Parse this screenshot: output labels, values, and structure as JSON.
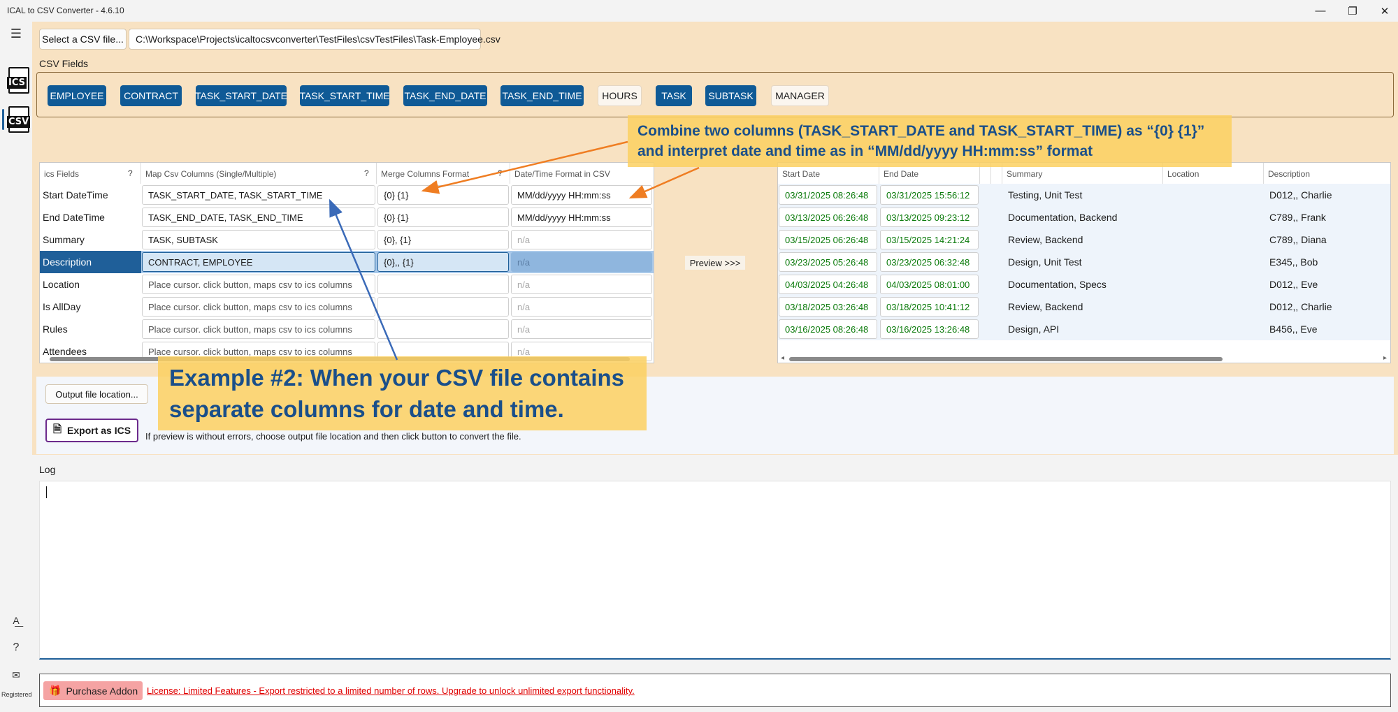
{
  "window": {
    "title": "ICAL to CSV Converter -  4.6.10"
  },
  "rail": {
    "ics_label": "ICS",
    "csv_label": "CSV",
    "registered": "Registered Jignesh De"
  },
  "file": {
    "select_button": "Select a CSV file...",
    "path": "C:\\Workspace\\Projects\\icaltocsvconverter\\TestFiles\\csvTestFiles\\Task-Employee.csv"
  },
  "csv_fields": {
    "label": "CSV Fields",
    "chips": [
      {
        "label": "EMPLOYEE",
        "mapped": true
      },
      {
        "label": "CONTRACT",
        "mapped": true
      },
      {
        "label": "TASK_START_DATE",
        "mapped": true
      },
      {
        "label": "TASK_START_TIME",
        "mapped": true
      },
      {
        "label": "TASK_END_DATE",
        "mapped": true
      },
      {
        "label": "TASK_END_TIME",
        "mapped": true
      },
      {
        "label": "HOURS",
        "mapped": false
      },
      {
        "label": "TASK",
        "mapped": true
      },
      {
        "label": "SUBTASK",
        "mapped": true
      },
      {
        "label": "MANAGER",
        "mapped": false
      }
    ]
  },
  "mapping": {
    "headers": {
      "ics": "ics Fields",
      "map": "Map Csv Columns (Single/Multiple)",
      "merge": "Merge Columns Format",
      "datetime": "Date/Time Format in CSV",
      "help": "?"
    },
    "rows": [
      {
        "field": "Start DateTime",
        "map": "TASK_START_DATE, TASK_START_TIME",
        "merge": "{0} {1}",
        "datetime": "MM/dd/yyyy HH:mm:ss"
      },
      {
        "field": "End DateTime",
        "map": "TASK_END_DATE, TASK_END_TIME",
        "merge": "{0} {1}",
        "datetime": "MM/dd/yyyy HH:mm:ss"
      },
      {
        "field": "Summary",
        "map": "TASK, SUBTASK",
        "merge": "{0}, {1}",
        "datetime": "n/a"
      },
      {
        "field": "Description",
        "map": "CONTRACT, EMPLOYEE",
        "merge": "{0},, {1}",
        "datetime": "n/a"
      },
      {
        "field": "Location",
        "map": "Place cursor. click button, maps csv to ics columns",
        "merge": "",
        "datetime": "n/a"
      },
      {
        "field": "Is AllDay",
        "map": "Place cursor. click button, maps csv to ics columns",
        "merge": "",
        "datetime": "n/a"
      },
      {
        "field": "Rules",
        "map": "Place cursor. click button, maps csv to ics columns",
        "merge": "",
        "datetime": "n/a"
      },
      {
        "field": "Attendees",
        "map": "Place cursor. click button, maps csv to ics columns",
        "merge": "",
        "datetime": "n/a"
      }
    ]
  },
  "preview_button": "Preview >>>",
  "preview": {
    "headers": {
      "start": "Start Date",
      "end": "End Date",
      "summary": "Summary",
      "location": "Location",
      "description": "Description"
    },
    "rows": [
      {
        "start": "03/31/2025 08:26:48",
        "end": "03/31/2025 15:56:12",
        "summary": "Testing, Unit Test",
        "location": "",
        "description": "D012,, Charlie"
      },
      {
        "start": "03/13/2025 06:26:48",
        "end": "03/13/2025 09:23:12",
        "summary": "Documentation, Backend",
        "location": "",
        "description": "C789,, Frank"
      },
      {
        "start": "03/15/2025 06:26:48",
        "end": "03/15/2025 14:21:24",
        "summary": "Review, Backend",
        "location": "",
        "description": "C789,, Diana"
      },
      {
        "start": "03/23/2025 05:26:48",
        "end": "03/23/2025 06:32:48",
        "summary": "Design, Unit Test",
        "location": "",
        "description": "E345,, Bob"
      },
      {
        "start": "04/03/2025 04:26:48",
        "end": "04/03/2025 08:01:00",
        "summary": "Documentation, Specs",
        "location": "",
        "description": "D012,, Eve"
      },
      {
        "start": "03/18/2025 03:26:48",
        "end": "03/18/2025 10:41:12",
        "summary": "Review, Backend",
        "location": "",
        "description": "D012,, Charlie"
      },
      {
        "start": "03/16/2025 08:26:48",
        "end": "03/16/2025 13:26:48",
        "summary": "Design, API",
        "location": "",
        "description": "B456,, Eve"
      }
    ]
  },
  "callouts": {
    "combine_line1": "Combine two columns (TASK_START_DATE and TASK_START_TIME) as “{0} {1}”",
    "combine_line2": "and interpret date and time as in “MM/dd/yyyy HH:mm:ss” format",
    "example_line1": "Example #2: When your CSV file contains",
    "example_line2": "separate columns for date and time."
  },
  "output": {
    "location_button": "Output file location...",
    "export_button": "Export as ICS",
    "hint": "If preview is without errors, choose output file location and then click button to convert the file."
  },
  "log": {
    "label": "Log",
    "content": ""
  },
  "footer": {
    "purchase_button": "Purchase Addon",
    "license": "License: Limited Features - Export restricted to a limited number of rows. Upgrade to unlock unlimited export functionality."
  },
  "colors": {
    "panel": "#f8e2c2",
    "chip_mapped": "#0f5a96",
    "callout": "#fcd060",
    "arrow_orange": "#ef7d22",
    "arrow_blue": "#3a6ab8",
    "license": "#e00000"
  }
}
